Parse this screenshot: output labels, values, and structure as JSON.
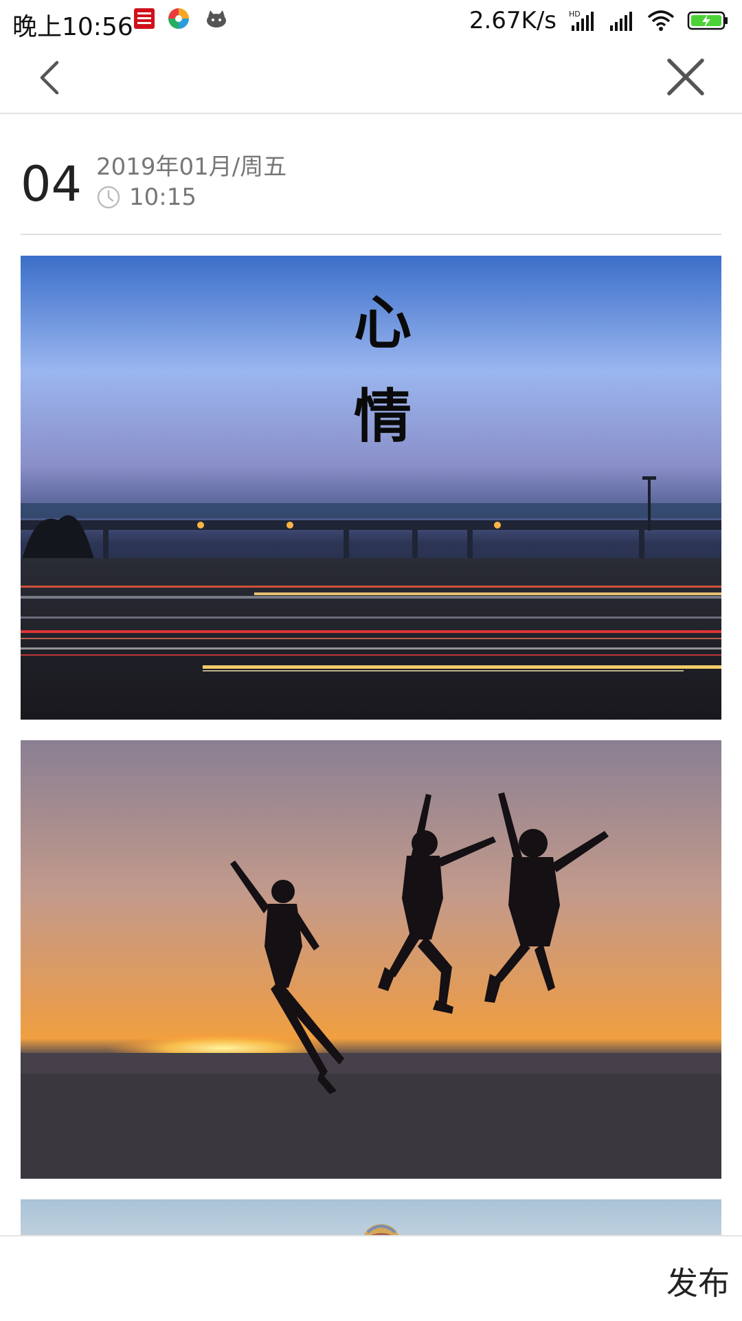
{
  "status_bar": {
    "time": "晚上10:56",
    "net_speed": "2.67K/s",
    "icons": [
      "netease-news-app-icon",
      "colorful-app-icon",
      "cat-app-icon",
      "hd-signal-icon",
      "signal-icon",
      "wifi-icon",
      "battery-charging-icon"
    ]
  },
  "nav": {
    "back_icon": "chevron-left-icon",
    "close_icon": "close-icon"
  },
  "entry": {
    "day": "04",
    "date": "2019年01月/周五",
    "time": "10:15"
  },
  "photos": [
    {
      "name": "city-night-light-trails",
      "text_overlay": [
        "心",
        "情"
      ]
    },
    {
      "name": "jumping-friends-sunset"
    },
    {
      "name": "hot-air-balloon-sky"
    }
  ],
  "bottom_bar": {
    "publish_label": "发布"
  },
  "colors": {
    "divider": "#e2e2e2",
    "secondary_text": "#777777",
    "primary_text": "#222222"
  }
}
